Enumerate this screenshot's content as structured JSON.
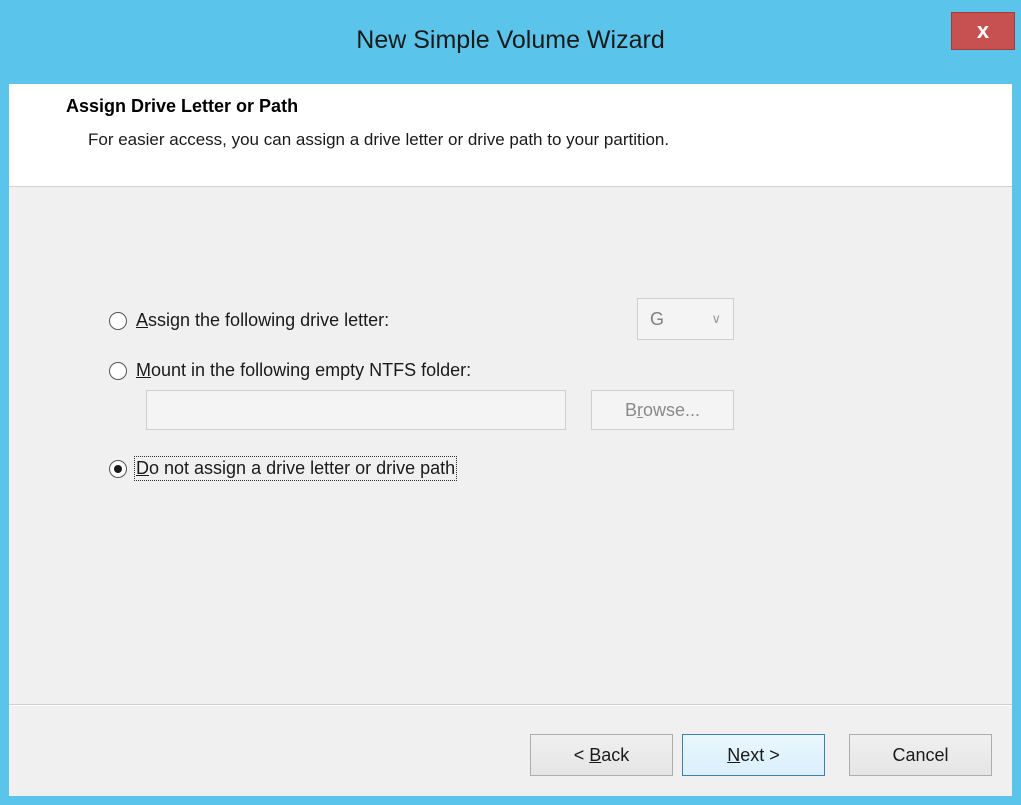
{
  "window": {
    "title": "New Simple Volume Wizard",
    "close_glyph": "x"
  },
  "header": {
    "title": "Assign Drive Letter or Path",
    "subtitle": "For easier access, you can assign a drive letter or drive path to your partition."
  },
  "options": {
    "assign_letter": {
      "mnemonic": "A",
      "rest": "ssign the following drive letter:",
      "checked": false
    },
    "mount_folder": {
      "mnemonic": "M",
      "rest": "ount in the following empty NTFS folder:",
      "checked": false
    },
    "no_assign": {
      "mnemonic": "D",
      "rest": "o not assign a drive letter or drive path",
      "checked": true
    }
  },
  "drive_letter": {
    "value": "G",
    "enabled": false
  },
  "folder_path": {
    "value": "",
    "enabled": false
  },
  "browse": {
    "pre": "B",
    "mnemonic": "r",
    "post": "owse...",
    "enabled": false
  },
  "buttons": {
    "back": {
      "pre": "< ",
      "mnemonic": "B",
      "post": "ack"
    },
    "next": {
      "mnemonic": "N",
      "post": "ext >"
    },
    "cancel": "Cancel"
  },
  "colors": {
    "title_bar": "#5bc4ea",
    "close_button": "#c75050"
  }
}
